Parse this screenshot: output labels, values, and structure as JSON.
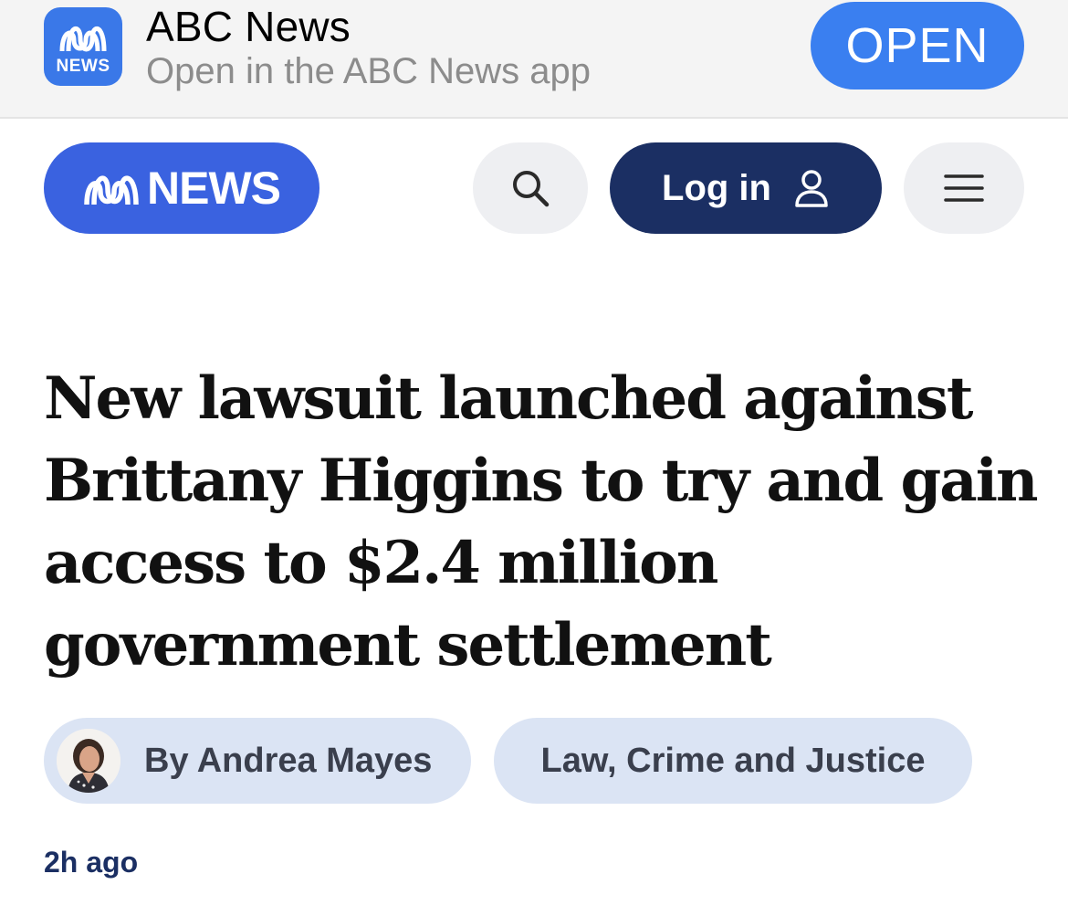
{
  "app_banner": {
    "icon_word": "NEWS",
    "app_name": "ABC News",
    "subtitle": "Open in the ABC News app",
    "open_label": "OPEN"
  },
  "header": {
    "logo_word": "NEWS",
    "login_label": "Log in",
    "icons": [
      "abc-logo-icon",
      "search-icon",
      "user-icon",
      "hamburger-menu-icon"
    ]
  },
  "article": {
    "headline": "New lawsuit launched against Brittany Higgins to try and gain access to $2.4 million government settlement",
    "author": "By Andrea Mayes",
    "topic": "Law, Crime and Justice",
    "published": "2h ago"
  },
  "colors": {
    "brand_blue": "#3a62e0",
    "open_button": "#3a7ff0",
    "login_navy": "#1b2f63",
    "pill_bg": "#dbe4f4"
  }
}
